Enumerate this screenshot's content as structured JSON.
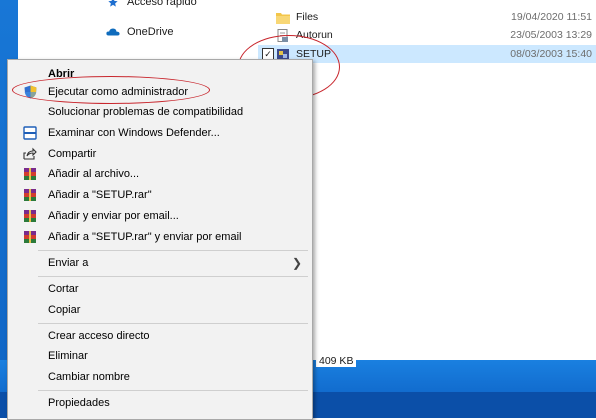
{
  "nav": {
    "items": [
      {
        "label": "Acceso rápido",
        "icon": "star-icon"
      },
      {
        "label": "OneDrive",
        "icon": "cloud-icon"
      }
    ]
  },
  "files": [
    {
      "name": "Files",
      "date": "19/04/2020 11:51",
      "icon": "folder-icon",
      "selected": false
    },
    {
      "name": "Autorun",
      "date": "23/05/2003 13:29",
      "icon": "file-icon",
      "selected": false
    },
    {
      "name": "SETUP",
      "date": "08/03/2003 15:40",
      "icon": "setup-icon",
      "selected": true
    }
  ],
  "status": {
    "size": "409 KB"
  },
  "context_menu": {
    "items": [
      {
        "label": "Abrir",
        "bold": true,
        "icon": ""
      },
      {
        "label": "Ejecutar como administrador",
        "icon": "uac-shield-icon"
      },
      {
        "label": "Solucionar problemas de compatibilidad",
        "icon": ""
      },
      {
        "label": "Examinar con Windows Defender...",
        "icon": "defender-icon"
      },
      {
        "label": "Compartir",
        "icon": "share-icon"
      },
      {
        "label": "Añadir al archivo...",
        "icon": "winrar-icon"
      },
      {
        "label": "Añadir a \"SETUP.rar\"",
        "icon": "winrar-icon"
      },
      {
        "label": "Añadir y enviar por email...",
        "icon": "winrar-icon"
      },
      {
        "label": "Añadir a \"SETUP.rar\" y enviar por email",
        "icon": "winrar-icon"
      },
      {
        "label": "Enviar a",
        "icon": "",
        "submenu": true
      },
      {
        "label": "Cortar",
        "icon": ""
      },
      {
        "label": "Copiar",
        "icon": ""
      },
      {
        "label": "Crear acceso directo",
        "icon": ""
      },
      {
        "label": "Eliminar",
        "icon": ""
      },
      {
        "label": "Cambiar nombre",
        "icon": ""
      },
      {
        "label": "Propiedades",
        "icon": ""
      }
    ]
  },
  "colors": {
    "selection": "#cce8ff",
    "annotation_circle": "#c8262d",
    "menu_bg": "#f2f2f2",
    "wallpaper": "#1877d6"
  }
}
